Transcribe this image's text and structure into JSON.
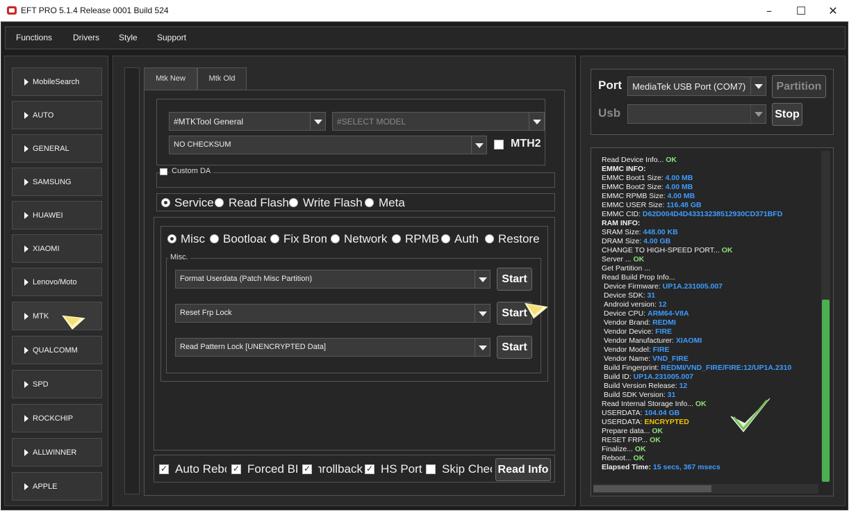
{
  "window": {
    "title": "EFT PRO 5.1.4 Release 0001 Build 524"
  },
  "menu": [
    "Functions",
    "Drivers",
    "Style",
    "Support"
  ],
  "brands": [
    "MobileSearch",
    "AUTO",
    "GENERAL",
    "SAMSUNG",
    "HUAWEI",
    "XIAOMI",
    "Lenovo/Moto",
    "MTK",
    "QUALCOMM",
    "SPD",
    "ROCKCHIP",
    "ALLWINNER",
    "APPLE"
  ],
  "selected_brand": "MTK",
  "tabs": {
    "mtk_new": "Mtk New",
    "mtk_old": "Mtk Old",
    "active": "Mtk New"
  },
  "mtk": {
    "tool_select": "#MTKTool General",
    "model_placeholder": "#SELECT MODEL",
    "checksum_select": "NO CHECKSUM",
    "mth2_label": "MTH2",
    "mth2_checked": false,
    "custom_da_label": "Custom DA",
    "custom_da_checked": false,
    "modes": [
      "Service",
      "Read Flash",
      "Write Flash",
      "Meta"
    ],
    "mode_selected": "Service",
    "subtabs": [
      "Misc",
      "Bootloader",
      "Fix Brom",
      "Network",
      "RPMB",
      "Auth",
      "Restore"
    ],
    "subtab_selected": "Misc",
    "misc_group_label": "Misc.",
    "operations": [
      {
        "select": "Format Userdata (Patch Misc Partition)",
        "button": "Start"
      },
      {
        "select": "Reset Frp Lock",
        "button": "Start"
      },
      {
        "select": "Read Pattern Lock [UNENCRYPTED Data]",
        "button": "Start"
      }
    ],
    "options": [
      {
        "label": "Auto Reboot",
        "checked": true
      },
      {
        "label": "Forced BROM",
        "checked": true
      },
      {
        "label": "Unrollback",
        "checked": true
      },
      {
        "label": "HS Port",
        "checked": true
      },
      {
        "label": "Skip Check",
        "checked": false
      }
    ],
    "read_info_button": "Read Info"
  },
  "connection": {
    "port_label": "Port",
    "port_value": "MediaTek USB Port (COM7)",
    "usb_label": "Usb",
    "usb_value": "",
    "partition_button": "Partition",
    "stop_button": "Stop"
  },
  "log": [
    {
      "text": "Read Device Info... ",
      "value": "OK",
      "style": "ok",
      "indent": 0
    },
    {
      "text": "EMMC INFO:",
      "value": "",
      "style": "",
      "indent": 1,
      "bold": true
    },
    {
      "text": "EMMC Boot1 Size: ",
      "value": "4.00 MB",
      "style": "blue",
      "indent": 0
    },
    {
      "text": "EMMC Boot2 Size: ",
      "value": "4.00 MB",
      "style": "blue",
      "indent": 0
    },
    {
      "text": "EMMC RPMB Size: ",
      "value": "4.00 MB",
      "style": "blue",
      "indent": 0
    },
    {
      "text": "EMMC USER Size: ",
      "value": "116.48 GB",
      "style": "blue",
      "indent": 0
    },
    {
      "text": "EMMC CID: ",
      "value": "D62D004D4D43313238512930CD371BFD",
      "style": "blue",
      "indent": 0
    },
    {
      "text": "RAM INFO:",
      "value": "",
      "style": "",
      "indent": 1,
      "bold": true
    },
    {
      "text": "SRAM Size: ",
      "value": "448.00 KB",
      "style": "blue",
      "indent": 0
    },
    {
      "text": "DRAM Size: ",
      "value": "4.00 GB",
      "style": "blue",
      "indent": 0
    },
    {
      "text": "CHANGE TO HIGH-SPEED PORT... ",
      "value": "OK",
      "style": "ok",
      "indent": 0
    },
    {
      "text": "Server ... ",
      "value": "OK",
      "style": "ok",
      "indent": 0
    },
    {
      "text": "Get Partition ...",
      "value": "",
      "style": "",
      "indent": 0
    },
    {
      "text": "Read Build Prop Info...",
      "value": "",
      "style": "",
      "indent": 0
    },
    {
      "text": "Device Firmware: ",
      "value": "UP1A.231005.007",
      "style": "blue",
      "indent": 2
    },
    {
      "text": "Device SDK: ",
      "value": "31",
      "style": "blue",
      "indent": 2
    },
    {
      "text": "Android version: ",
      "value": "12",
      "style": "blue",
      "indent": 2
    },
    {
      "text": "Device CPU: ",
      "value": "ARM64-V8A",
      "style": "blue",
      "indent": 2
    },
    {
      "text": "Vendor Brand: ",
      "value": "REDMI",
      "style": "blue",
      "indent": 2
    },
    {
      "text": "Vendor Device: ",
      "value": "FIRE",
      "style": "blue",
      "indent": 2
    },
    {
      "text": "Vendor Manufacturer: ",
      "value": "XIAOMI",
      "style": "blue",
      "indent": 2
    },
    {
      "text": "Vendor Model: ",
      "value": "FIRE",
      "style": "blue",
      "indent": 2
    },
    {
      "text": "Vendor Name: ",
      "value": "VND_FIRE",
      "style": "blue",
      "indent": 2
    },
    {
      "text": "Build Fingerprint: ",
      "value": "REDMI/VND_FIRE/FIRE:12/UP1A.2310",
      "style": "blue",
      "indent": 2
    },
    {
      "text": "Build ID: ",
      "value": "UP1A.231005.007",
      "style": "blue",
      "indent": 2
    },
    {
      "text": "Build Version Release: ",
      "value": "12",
      "style": "blue",
      "indent": 2
    },
    {
      "text": "Build SDK Version: ",
      "value": "31",
      "style": "blue",
      "indent": 2
    },
    {
      "text": "Read Internal Storage Info... ",
      "value": "OK",
      "style": "ok",
      "indent": 0
    },
    {
      "text": "USERDATA: ",
      "value": "104.04 GB",
      "style": "blue",
      "indent": 0
    },
    {
      "text": "USERDATA: ",
      "value": "ENCRYPTED",
      "style": "yellow",
      "indent": 0
    },
    {
      "text": "Prepare data... ",
      "value": "OK",
      "style": "ok",
      "indent": 0
    },
    {
      "text": "RESET FRP... ",
      "value": "OK",
      "style": "ok",
      "indent": 0
    },
    {
      "text": "Finalize... ",
      "value": "OK",
      "style": "ok",
      "indent": 0
    },
    {
      "text": "Reboot... ",
      "value": "OK",
      "style": "ok",
      "indent": 0
    },
    {
      "text": "Elapsed Time: ",
      "value": "15 secs, 367 msecs",
      "style": "blue",
      "indent": 0,
      "bold": true
    }
  ],
  "colors": {
    "ok": "#8fe07c",
    "value": "#3d9cff",
    "warning": "#f2c200",
    "scroll_thumb": "#4caf50",
    "background": "#1d1d1d"
  }
}
